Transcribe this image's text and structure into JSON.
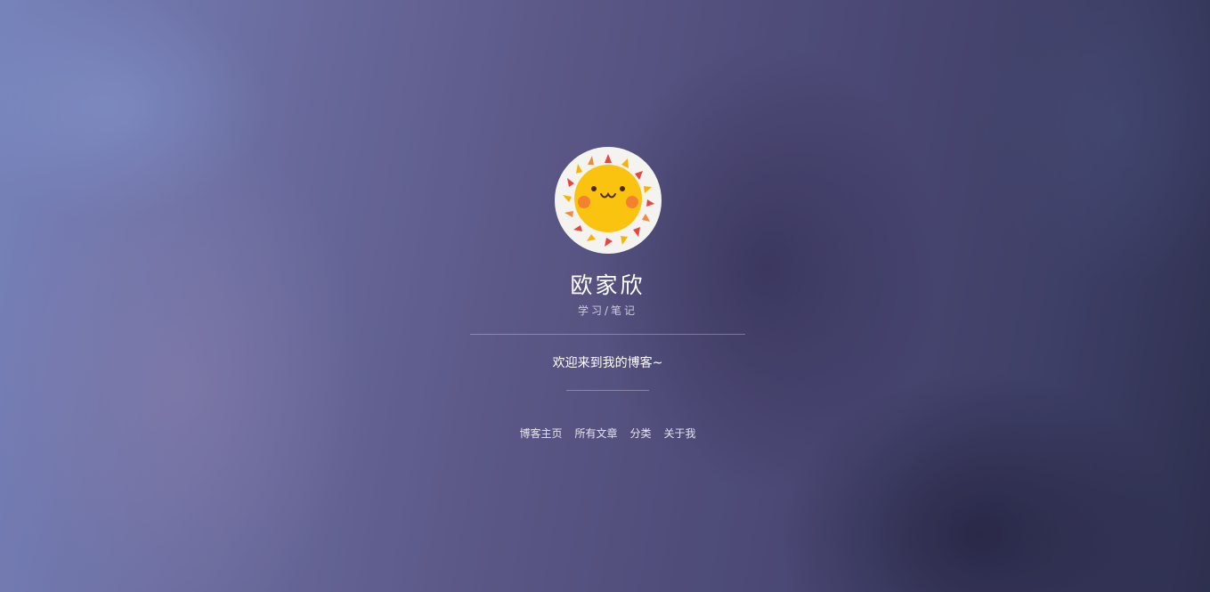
{
  "profile": {
    "name": "欧家欣",
    "subtitle": "学习/笔记"
  },
  "welcome_text": "欢迎来到我的博客~",
  "nav": {
    "items": [
      {
        "label": "博客主页"
      },
      {
        "label": "所有文章"
      },
      {
        "label": "分类"
      },
      {
        "label": "关于我"
      }
    ]
  },
  "colors": {
    "text": "#ffffff",
    "sun_face": "#f9c310",
    "avatar_bg": "#f5f3ef"
  },
  "icons": {
    "avatar": "sun-face-icon"
  }
}
